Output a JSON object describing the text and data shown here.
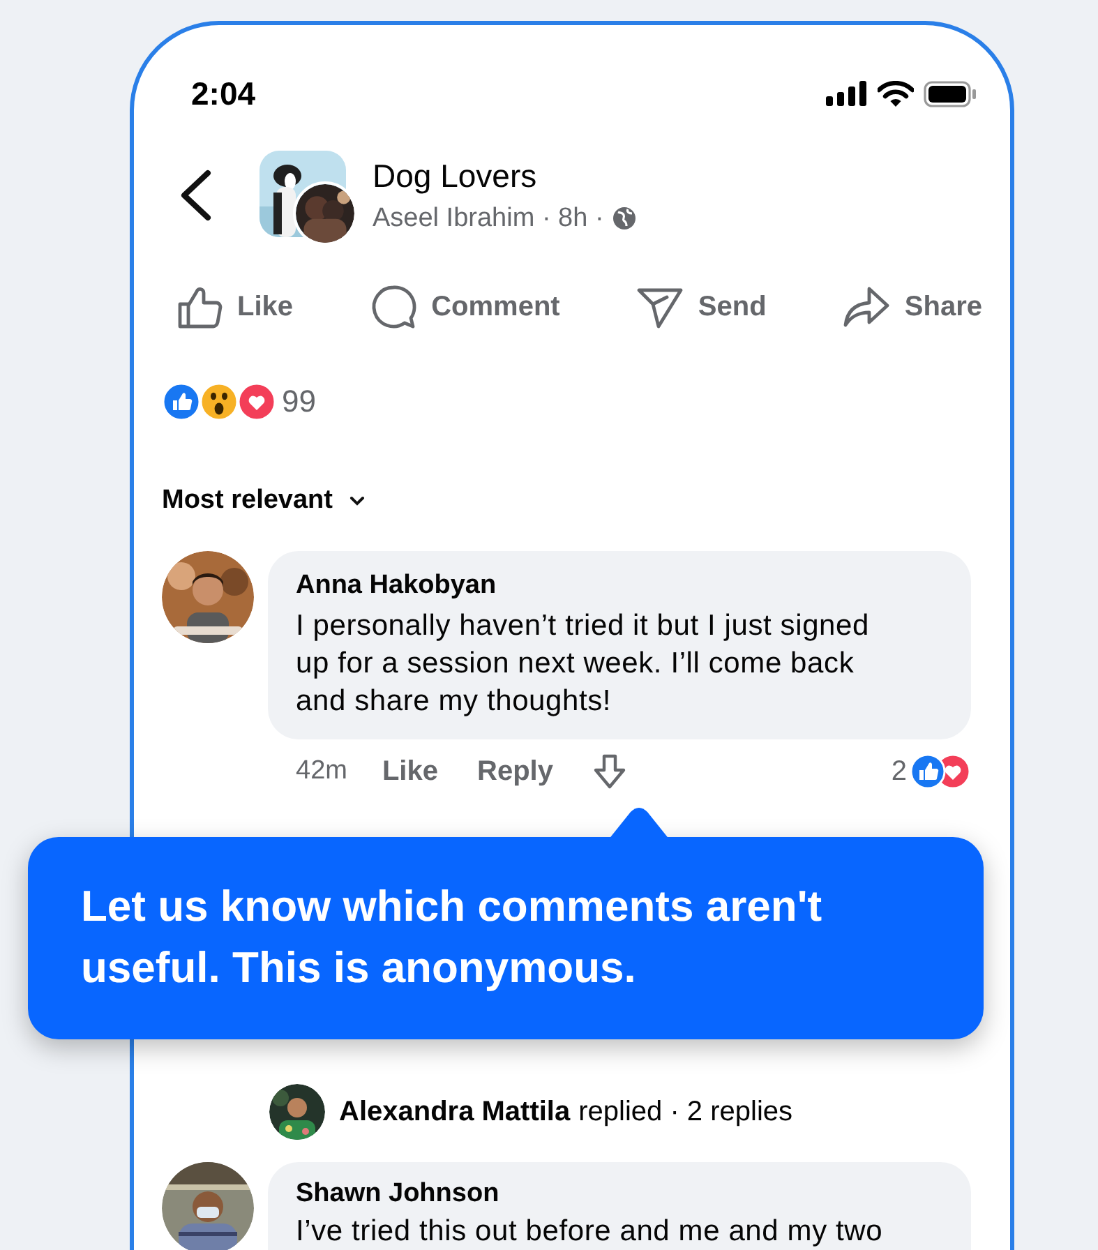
{
  "status_bar": {
    "time": "2:04"
  },
  "header": {
    "title": "Dog Lovers",
    "byline": "Aseel Ibrahim · 8h ·"
  },
  "actions": [
    {
      "kind": "like",
      "label": "Like"
    },
    {
      "kind": "comment",
      "label": "Comment"
    },
    {
      "kind": "send",
      "label": "Send"
    },
    {
      "kind": "share",
      "label": "Share"
    }
  ],
  "reaction_summary": {
    "count": "99"
  },
  "sort": {
    "label": "Most relevant"
  },
  "comments": [
    {
      "author": "Anna Hakobyan",
      "text": "I personally haven’t tried it but I just signed up for a session next week. I’ll come back and share my thoughts!",
      "time": "42m",
      "like": "Like",
      "reply": "Reply",
      "reaction_count": "2"
    },
    {
      "author": "Shawn Johnson",
      "text": "I’ve tried this out before and me and my two"
    }
  ],
  "reply_summary": {
    "author": "Alexandra Mattila",
    "text": "replied · 2 replies"
  },
  "tooltip": {
    "text": "Let us know which comments aren't useful. This is anonymous."
  }
}
